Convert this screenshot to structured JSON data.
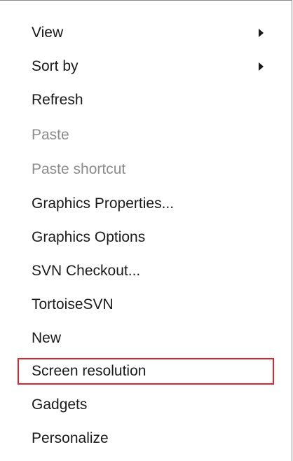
{
  "context_menu": {
    "items": [
      {
        "label": "View",
        "has_submenu": true,
        "enabled": true
      },
      {
        "label": "Sort by",
        "has_submenu": true,
        "enabled": true
      },
      {
        "label": "Refresh",
        "has_submenu": false,
        "enabled": true
      },
      {
        "label": "Paste",
        "has_submenu": false,
        "enabled": false
      },
      {
        "label": "Paste shortcut",
        "has_submenu": false,
        "enabled": false
      },
      {
        "label": "Graphics Properties...",
        "has_submenu": false,
        "enabled": true
      },
      {
        "label": "Graphics Options",
        "has_submenu": false,
        "enabled": true
      },
      {
        "label": "SVN Checkout...",
        "has_submenu": false,
        "enabled": true
      },
      {
        "label": "TortoiseSVN",
        "has_submenu": false,
        "enabled": true
      },
      {
        "label": "New",
        "has_submenu": false,
        "enabled": true
      },
      {
        "label": "Screen resolution",
        "has_submenu": false,
        "enabled": true,
        "highlighted": true
      },
      {
        "label": "Gadgets",
        "has_submenu": false,
        "enabled": true
      },
      {
        "label": "Personalize",
        "has_submenu": false,
        "enabled": true
      }
    ],
    "colors": {
      "text": "#1a1a1a",
      "disabled_text": "#8c8c8c",
      "highlight_border": "#d9262f",
      "border": "#8a8a8a"
    }
  }
}
